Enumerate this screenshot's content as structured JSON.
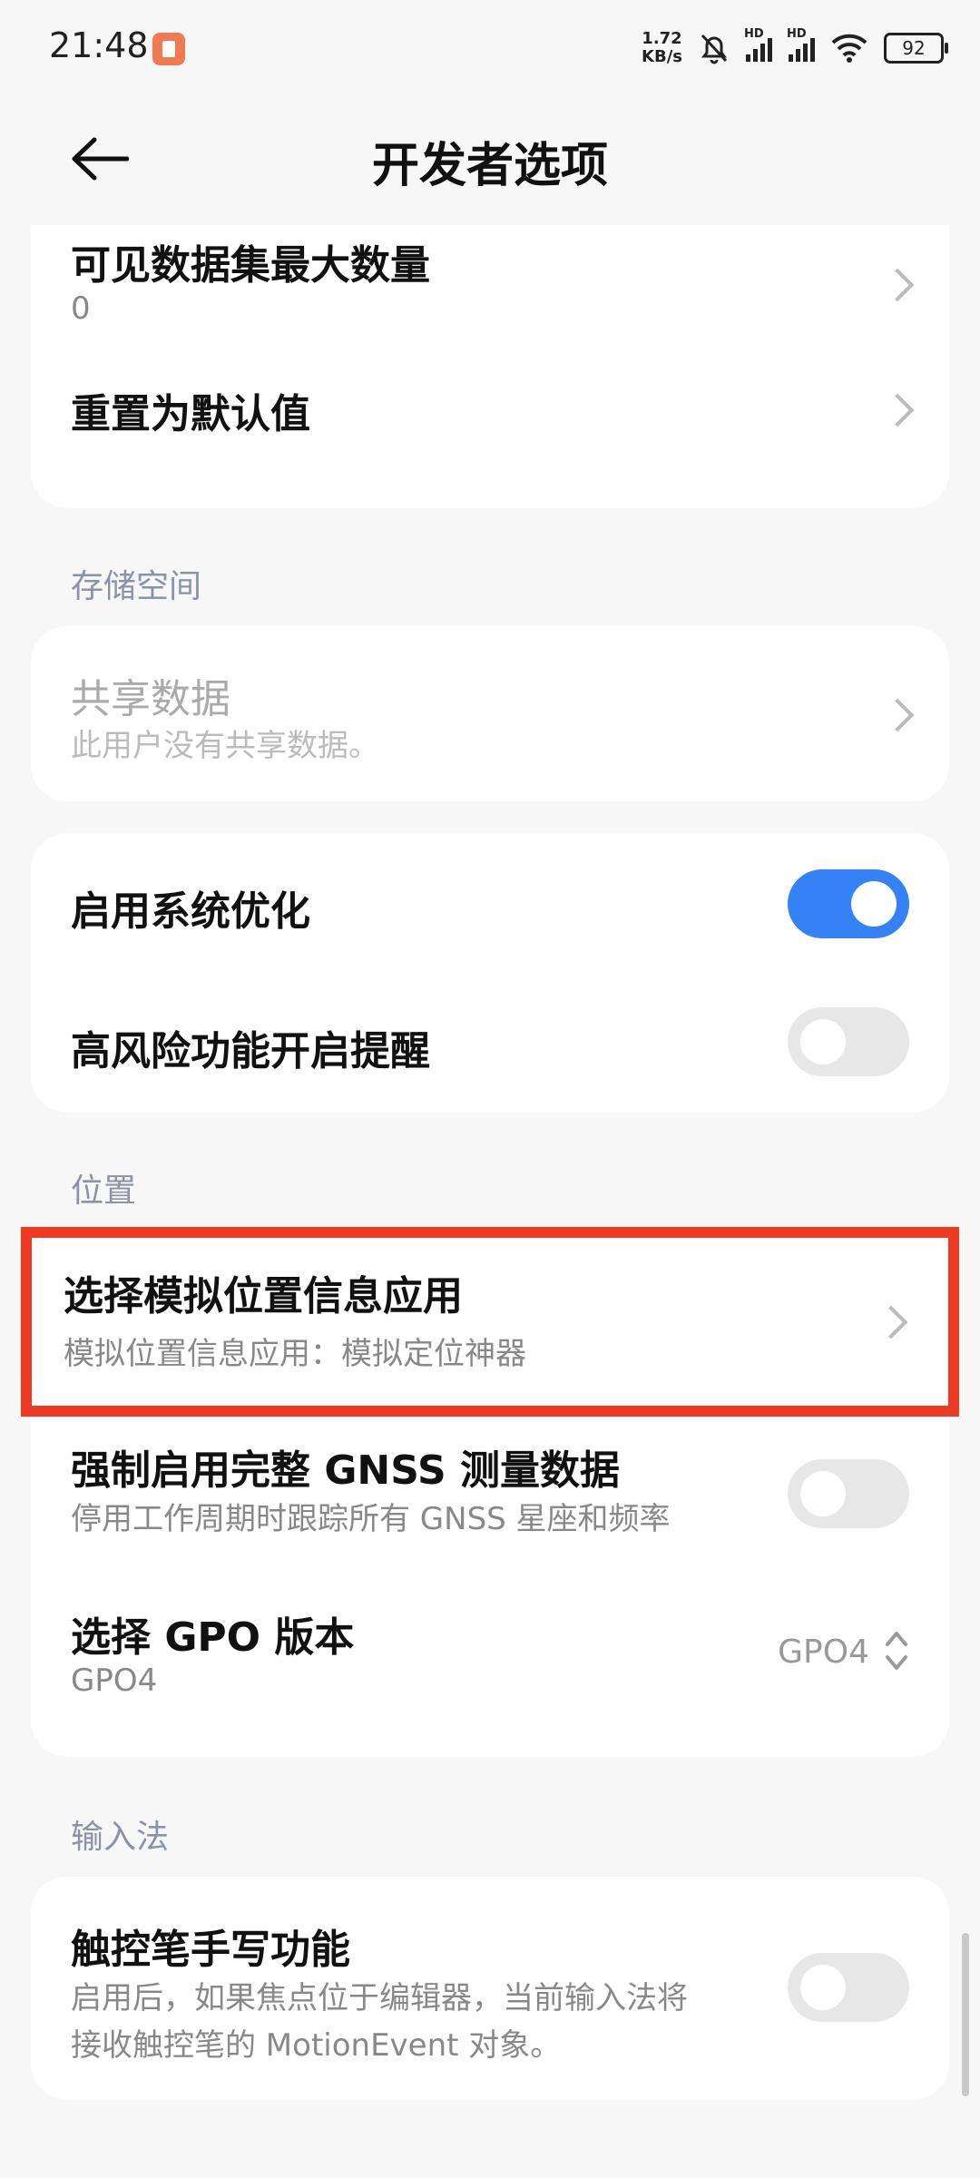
{
  "status_bar": {
    "time": "21:48",
    "speed_value": "1.72",
    "speed_unit": "KB/s",
    "hd": "HD",
    "battery": "92",
    "bell_icon": "bell-muted-icon",
    "wifi_icon": "wifi-icon"
  },
  "header": {
    "title": "开发者选项",
    "back_icon": "back-arrow-icon"
  },
  "card1": {
    "max_dataset_title": "可见数据集最大数量",
    "max_dataset_value": "0",
    "reset_title": "重置为默认值"
  },
  "storage": {
    "section": "存储空间",
    "shared_title": "共享数据",
    "shared_sub": "此用户没有共享数据。"
  },
  "system": {
    "optimize_title": "启用系统优化",
    "optimize_on": true,
    "risk_title": "高风险功能开启提醒",
    "risk_on": false
  },
  "location": {
    "section": "位置",
    "mock_title": "选择模拟位置信息应用",
    "mock_sub": "模拟位置信息应用：模拟定位神器",
    "gnss_title": "强制启用完整 GNSS 测量数据",
    "gnss_sub": "停用工作周期时跟踪所有 GNSS 星座和频率",
    "gnss_on": false,
    "gpo_title": "选择 GPO 版本",
    "gpo_sub": "GPO4",
    "gpo_value": "GPO4"
  },
  "input": {
    "section": "输入法",
    "stylus_title": "触控笔手写功能",
    "stylus_sub_line1": "启用后，如果焦点位于编辑器，当前输入法将",
    "stylus_sub_line2": "接收触控笔的 MotionEvent 对象。",
    "stylus_on": false
  },
  "colors": {
    "accent": "#3482f6",
    "highlight_border": "#ee3a22",
    "section_text": "#8b93a8"
  }
}
